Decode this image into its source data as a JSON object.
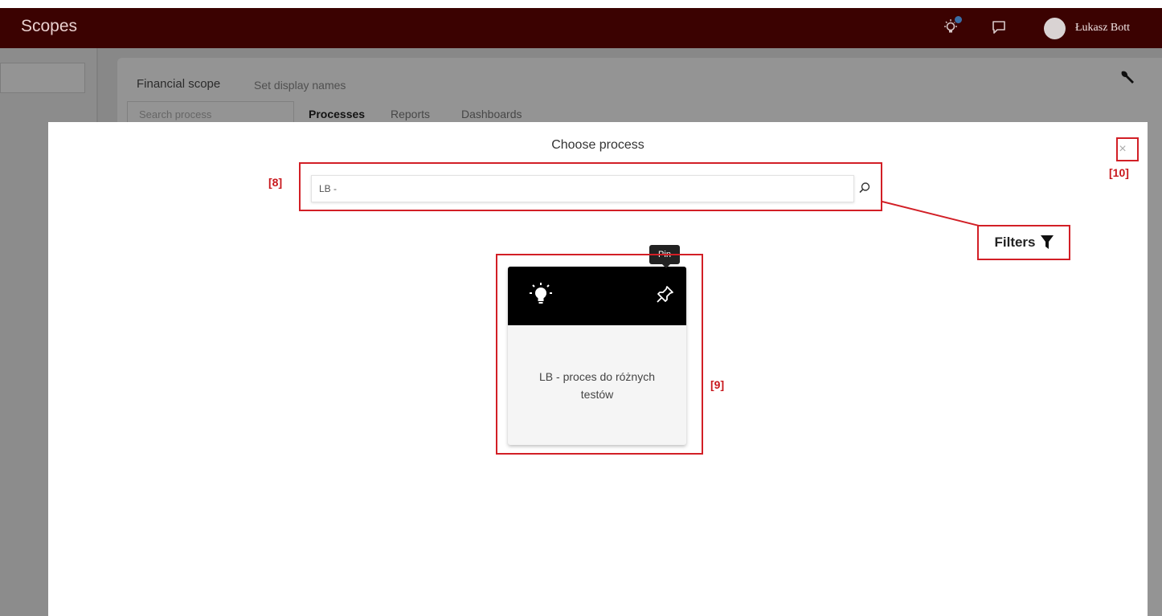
{
  "topbar": {
    "app_title": "Scopes",
    "user_name": "Łukasz Bott",
    "icons": [
      "lightbulb-icon",
      "chat-icon",
      "avatar"
    ]
  },
  "background_page": {
    "scope_title": "Financial scope",
    "set_display_names": "Set display names",
    "search_placeholder": "Search process",
    "tabs": [
      {
        "label": "Processes",
        "active": true
      },
      {
        "label": "Reports",
        "active": false
      },
      {
        "label": "Dashboards",
        "active": false
      }
    ]
  },
  "modal": {
    "title": "Choose process",
    "close_label": "×",
    "search_value": "LB -",
    "process_cards": [
      {
        "name": "LB - proces do różnych testów",
        "icon": "lightbulb-icon",
        "pin_icon": "pin-icon"
      }
    ],
    "pin_tooltip": "Pin"
  },
  "annotations": {
    "search_label": "[8]",
    "card_label": "[9]",
    "close_label": "[10]",
    "filters_label": "Filters"
  },
  "colors": {
    "topbar_bg": "#3b0201",
    "annotation_red": "#d21f26",
    "card_header": "#000000",
    "card_body": "#f5f5f5"
  }
}
